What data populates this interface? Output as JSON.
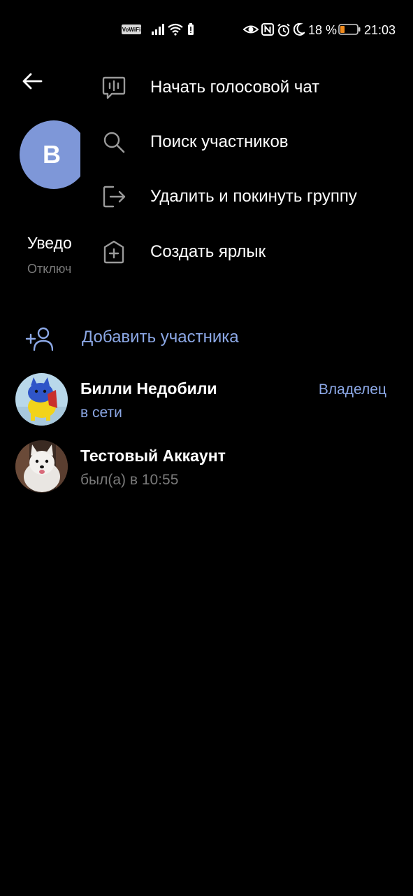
{
  "status_bar": {
    "vowifi": "VoWiFi",
    "battery_percent": "18 %",
    "time": "21:03",
    "icons": [
      "signal-icon",
      "wifi-icon",
      "battery-saver-icon",
      "eye-icon",
      "nfc-icon",
      "alarm-icon",
      "moon-icon",
      "battery-icon"
    ],
    "battery_level": 0.18
  },
  "header": {
    "back_icon": "arrow-left-icon",
    "group_avatar_letter": "В",
    "group_avatar_color": "#7e97d8"
  },
  "notifications": {
    "title": "Уведо",
    "subtitle": "Отключ"
  },
  "menu": {
    "items": [
      {
        "label": "Начать голосовой чат",
        "icon": "voice-chat-icon"
      },
      {
        "label": "Поиск участников",
        "icon": "search-icon"
      },
      {
        "label": "Удалить и покинуть группу",
        "icon": "leave-icon"
      },
      {
        "label": "Создать ярлык",
        "icon": "add-shortcut-icon"
      }
    ]
  },
  "add_member": {
    "label": "Добавить участника",
    "icon": "add-user-icon"
  },
  "members": [
    {
      "name": "Билли Недобили",
      "status": "в сети",
      "role": "Владелец",
      "status_color": "#8ca8e6"
    },
    {
      "name": "Тестовый Аккаунт",
      "status": "был(а) в 10:55",
      "role": "",
      "status_color": "#7a7a7a"
    }
  ],
  "colors": {
    "accent": "#8ca8e6",
    "background": "#000000",
    "muted_text": "#7a7a7a"
  }
}
